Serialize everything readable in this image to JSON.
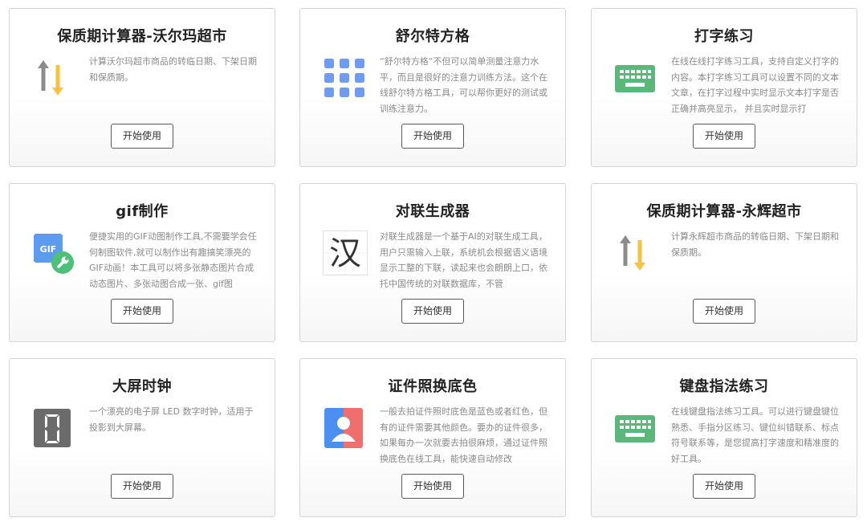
{
  "tools": [
    {
      "title": "保质期计算器-沃尔玛超市",
      "desc": "计算沃尔玛超市商品的转临日期、下架日期和保质期。",
      "button": "开始使用",
      "icon": "up-down-arrows-icon"
    },
    {
      "title": "舒尔特方格",
      "desc": "“舒尔特方格”不但可以简单测量注意力水平，而且是很好的注意力训练方法。这个在线舒尔特方格工具，可以帮你更好的测试或训练注意力。",
      "button": "开始使用",
      "icon": "grid-icon"
    },
    {
      "title": "打字练习",
      "desc": "在线在线打字练习工具，支持自定义打字的内容。本打字练习工具可以设置不同的文本文章，在打字过程中实时显示文本打字是否正确并高亮显示， 并且实时显示打",
      "button": "开始使用",
      "icon": "keyboard-icon"
    },
    {
      "title": "gif制作",
      "desc": "便捷实用的GIF动图制作工具,不需要学会任何制图软件,就可以制作出有趣搞笑漂亮的GIF动画！本工具可以将多张静态图片合成动态图片、多张动图合成一张、gif图",
      "button": "开始使用",
      "icon": "gif-wrench-icon"
    },
    {
      "title": "对联生成器",
      "desc": "对联生成器是一个基于AI的对联生成工具，用户只需输入上联，系统机会根据语义语境显示工整的下联，读起来也会朗朗上口，依托中国传统的对联数据库，不管",
      "button": "开始使用",
      "icon": "chinese-character-icon",
      "icon_glyph": "汉"
    },
    {
      "title": "保质期计算器-永辉超市",
      "desc": "计算永辉超市商品的转临日期、下架日期和保质期。",
      "button": "开始使用",
      "icon": "up-down-arrows-icon"
    },
    {
      "title": "大屏时钟",
      "desc": "一个漂亮的电子屏 LED 数字时钟，适用于投影到大屏幕。",
      "button": "开始使用",
      "icon": "led-digit-icon"
    },
    {
      "title": "证件照换底色",
      "desc": "一般去拍证件照时底色是蓝色或者红色，但有的证件需要其他颜色。要办的证件很多，如果每办一次就要去拍很麻烦，通过证件照换底色在线工具，能快速自动修改",
      "button": "开始使用",
      "icon": "id-photo-icon"
    },
    {
      "title": "键盘指法练习",
      "desc": "在线键盘指法练习工具。可以进行键盘键位熟悉、手指分区练习、键位纠错联系、标点符号联系等，是您提高打字速度和精准度的好工具。",
      "button": "开始使用",
      "icon": "keyboard-icon"
    }
  ],
  "colors": {
    "arrow_gray": "#8c8c8c",
    "arrow_yellow": "#f5c242",
    "grid_blue": "#6f9cf0",
    "keyboard_green": "#5cb87a",
    "gif_blue": "#5b9cf0",
    "wrench_green": "#4ec07a",
    "id_blue": "#4d8ff0",
    "id_red": "#ef6f6f",
    "led_gray": "#6b6b6b"
  }
}
